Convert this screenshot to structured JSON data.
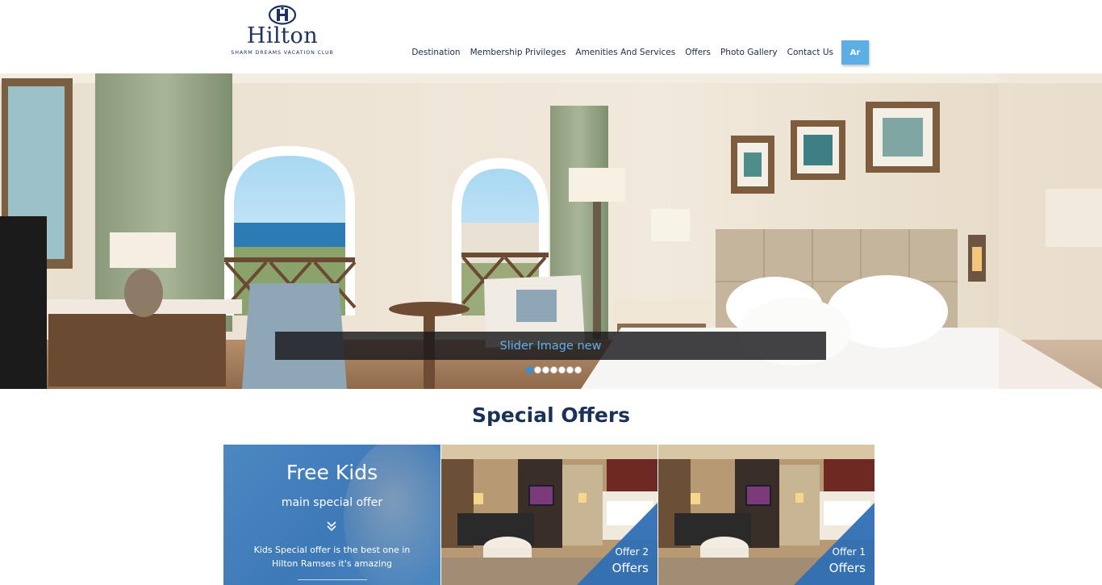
{
  "header": {
    "logo": {
      "wordmark": "Hilton",
      "subtitle": "SHARM DREAMS VACATION CLUB"
    },
    "nav": [
      {
        "label": "Destination"
      },
      {
        "label": "Membership Privileges"
      },
      {
        "label": "Amenities And Services"
      },
      {
        "label": "Offers"
      },
      {
        "label": "Photo Gallery"
      },
      {
        "label": "Contact Us"
      }
    ],
    "language_button": "Ar"
  },
  "hero": {
    "caption": "Slider Image new",
    "slide_count": 7,
    "active_slide": 1
  },
  "special_offers": {
    "title": "Special Offers",
    "featured": {
      "title": "Free Kids",
      "subtitle": "main special offer",
      "description": "Kids Special offer is the best one in Hilton Ramses it's amazing"
    },
    "cards": [
      {
        "small_label": "Offer 2",
        "big_label": "Offers"
      },
      {
        "small_label": "Offer 1",
        "big_label": "Offers"
      }
    ]
  },
  "colors": {
    "navy": "#1b3157",
    "accent_blue": "#5daee4",
    "offer_blue": "#3e79b7",
    "caption_text": "#5fb1ea"
  }
}
